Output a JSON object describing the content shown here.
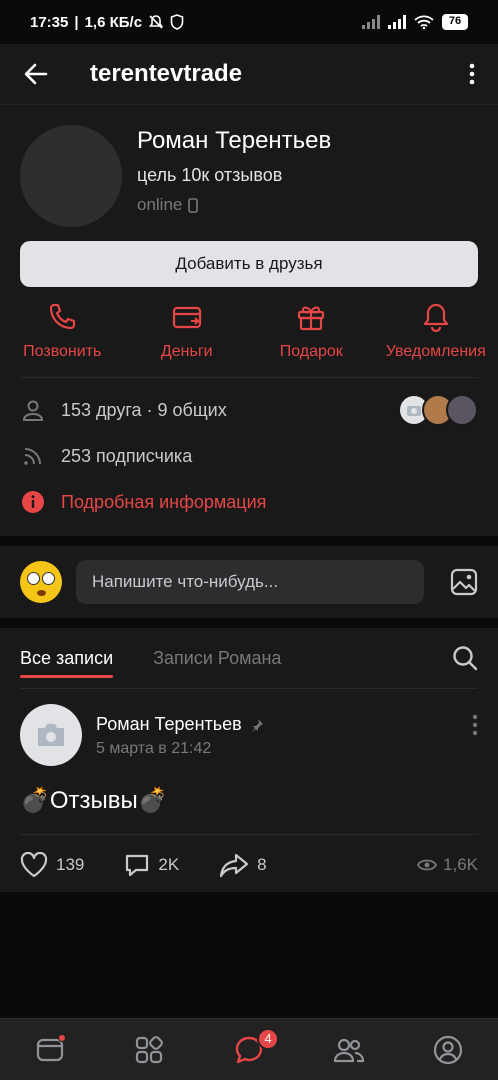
{
  "status_bar": {
    "time": "17:35",
    "speed": "1,6 КБ/с",
    "battery": "76"
  },
  "header": {
    "title": "terentevtrade"
  },
  "profile": {
    "name": "Роман Терентьев",
    "status": "цель 10к отзывов",
    "online": "online",
    "add_friend_label": "Добавить в друзья"
  },
  "actions": [
    {
      "label": "Позвонить",
      "icon": "phone-icon"
    },
    {
      "label": "Деньги",
      "icon": "wallet-icon"
    },
    {
      "label": "Подарок",
      "icon": "gift-icon"
    },
    {
      "label": "Уведомления",
      "icon": "bell-icon"
    }
  ],
  "info": {
    "friends": "153 друга · 9 общих",
    "followers": "253 подписчика",
    "details": "Подробная информация"
  },
  "compose": {
    "placeholder": "Напишите что-нибудь..."
  },
  "tabs": [
    {
      "label": "Все записи",
      "active": true
    },
    {
      "label": "Записи Романа",
      "active": false
    }
  ],
  "post": {
    "author": "Роман Терентьев",
    "date": "5 марта в 21:42",
    "text": "💣Отзывы💣",
    "likes": "139",
    "comments": "2K",
    "shares": "8",
    "views": "1,6K"
  },
  "bottom_nav": {
    "messages_badge": "4"
  },
  "colors": {
    "accent": "#e64646",
    "card": "#191919",
    "background": "#0a0a0a"
  }
}
